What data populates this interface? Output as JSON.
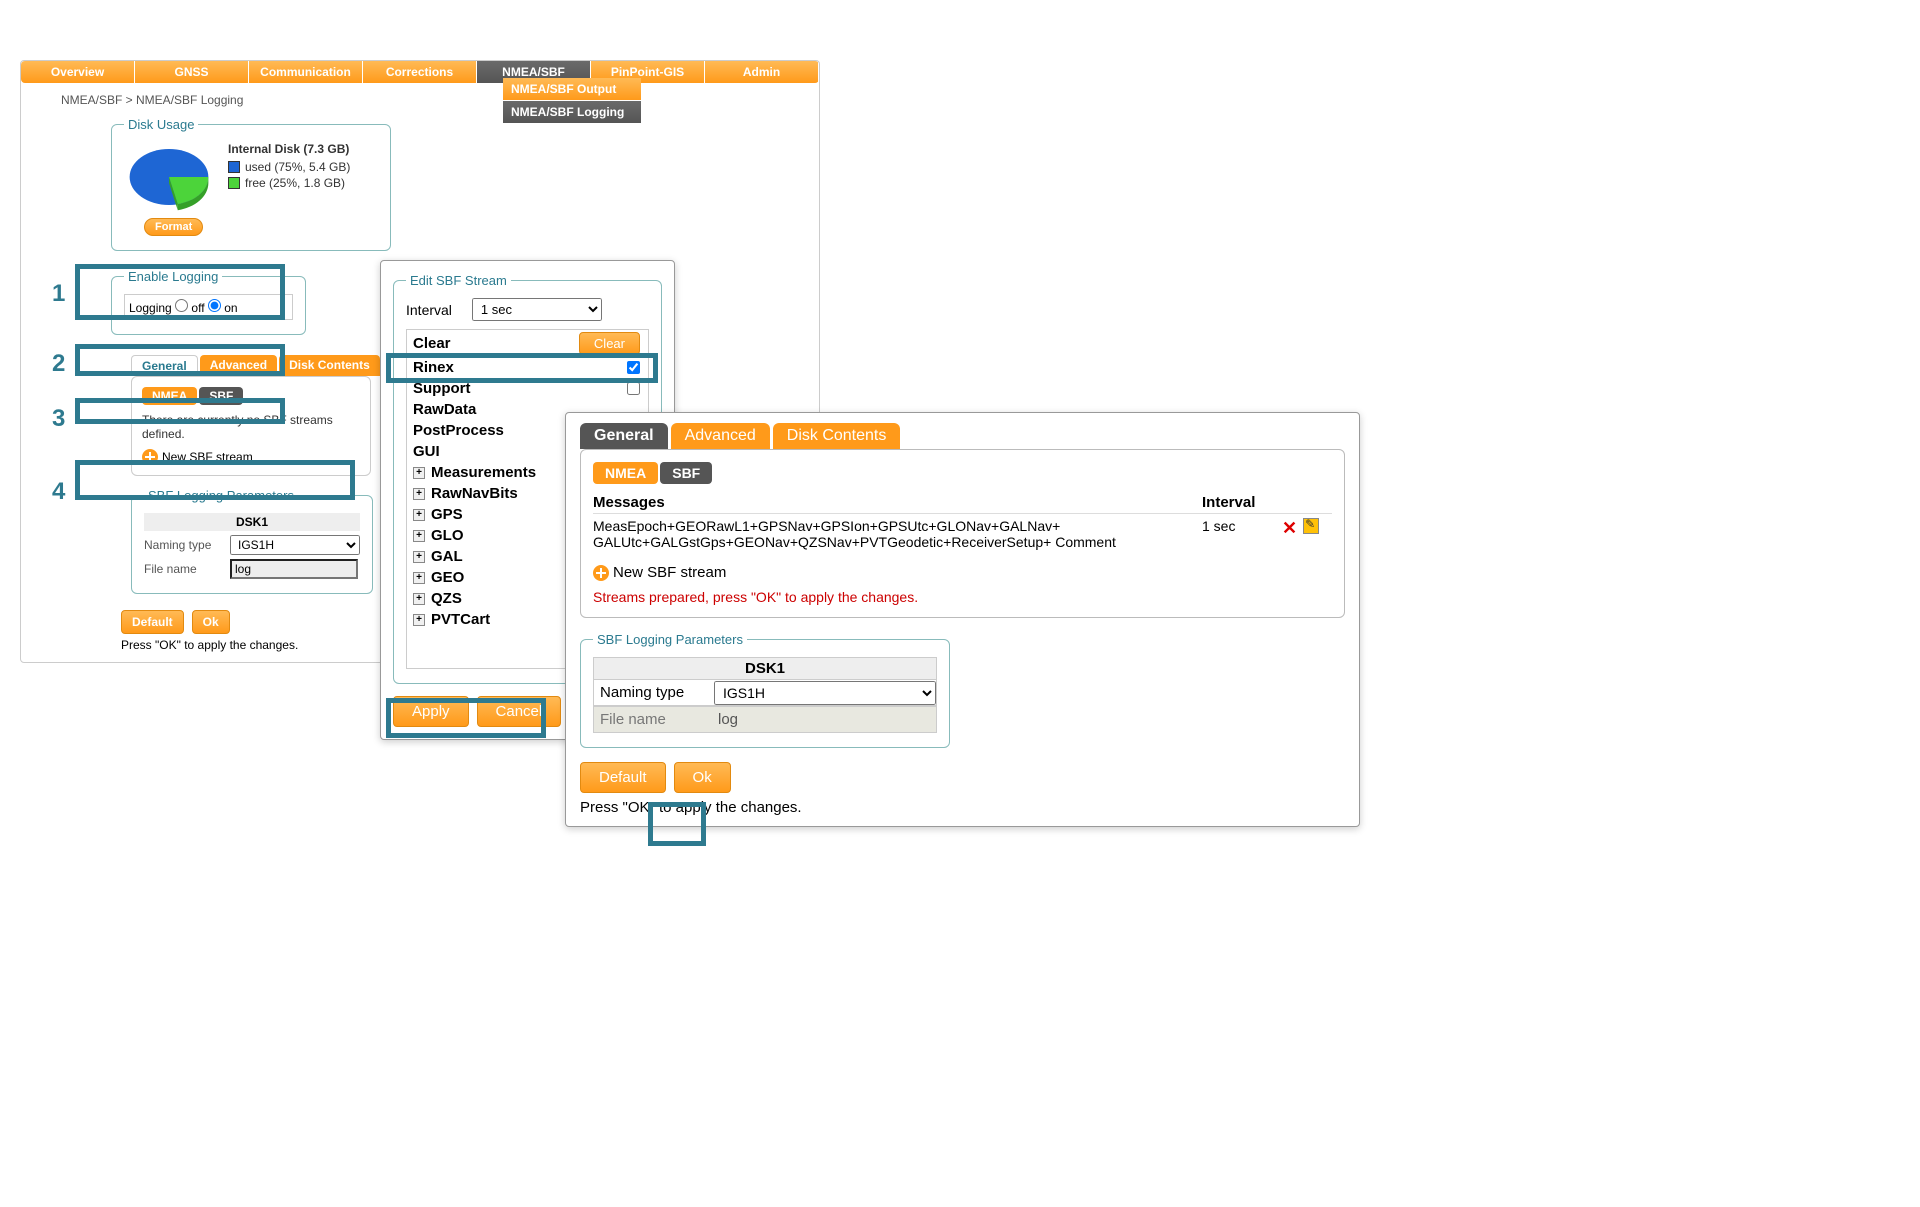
{
  "topnav": [
    "Overview",
    "GNSS",
    "Communication",
    "Corrections",
    "NMEA/SBF",
    "PinPoint-GIS",
    "Admin"
  ],
  "topnav_active": 4,
  "subnav": [
    {
      "label": "NMEA/SBF Output",
      "cls": "orange"
    },
    {
      "label": "NMEA/SBF Logging",
      "cls": "active"
    }
  ],
  "breadcrumb": "NMEA/SBF > NMEA/SBF Logging",
  "disk": {
    "legend_title": "Disk Usage",
    "title": "Internal Disk (7.3 GB)",
    "used": {
      "label": "used (75%, 5.4 GB)",
      "color": "#1e66d4",
      "pct": 75
    },
    "free": {
      "label": "free (25%, 1.8 GB)",
      "color": "#4cd43a",
      "pct": 25
    },
    "format": "Format"
  },
  "chart_data": {
    "type": "pie",
    "title": "Internal Disk (7.3 GB)",
    "series": [
      {
        "name": "used",
        "value": 5.4,
        "pct": 75,
        "color": "#1e66d4"
      },
      {
        "name": "free",
        "value": 1.8,
        "pct": 25,
        "color": "#4cd43a"
      }
    ],
    "unit": "GB",
    "total": 7.3
  },
  "enable": {
    "legend": "Enable Logging",
    "label": "Logging",
    "off": "off",
    "on": "on",
    "value": "on"
  },
  "subtabs": [
    "General",
    "Advanced",
    "Disk Contents"
  ],
  "mini": {
    "nmea": "NMEA",
    "sbf": "SBF"
  },
  "no_streams": "There are currently no SBF streams defined.",
  "new_stream": "New SBF stream",
  "params": {
    "legend": "SBF Logging Parameters",
    "dsk": "DSK1",
    "naming_label": "Naming type",
    "naming": "IGS1H",
    "file_label": "File name",
    "file": "log"
  },
  "actions": {
    "default": "Default",
    "ok": "Ok"
  },
  "hint": "Press \"OK\" to apply the changes.",
  "steps": [
    "1",
    "2",
    "3",
    "4"
  ],
  "edit": {
    "legend": "Edit SBF Stream",
    "interval_label": "Interval",
    "interval": "1 sec",
    "clear_label": "Clear",
    "clear_btn": "Clear",
    "rows": [
      {
        "label": "Rinex",
        "checked": true
      },
      {
        "label": "Support",
        "checked": false
      },
      {
        "label": "RawData"
      },
      {
        "label": "PostProcess"
      },
      {
        "label": "GUI"
      },
      {
        "label": "Measurements",
        "exp": true,
        "indent": true
      },
      {
        "label": "RawNavBits",
        "exp": true,
        "indent": true
      },
      {
        "label": "GPS",
        "exp": true,
        "indent": true
      },
      {
        "label": "GLO",
        "exp": true,
        "indent": true
      },
      {
        "label": "GAL",
        "exp": true,
        "indent": true
      },
      {
        "label": "GEO",
        "exp": true,
        "indent": true
      },
      {
        "label": "QZS",
        "exp": true,
        "indent": true
      },
      {
        "label": "PVTCart",
        "exp": true,
        "indent": true
      }
    ],
    "apply": "Apply",
    "cancel": "Cancel"
  },
  "result": {
    "tabs": [
      "General",
      "Advanced",
      "Disk Contents"
    ],
    "msg_head": "Messages",
    "int_head": "Interval",
    "messages": "MeasEpoch+GEORawL1+GPSNav+GPSIon+GPSUtc+GLONav+GALNav+ GALUtc+GALGstGps+GEONav+QZSNav+PVTGeodetic+ReceiverSetup+ Comment",
    "interval": "1 sec",
    "prepared": "Streams prepared, press \"OK\" to apply the changes."
  }
}
